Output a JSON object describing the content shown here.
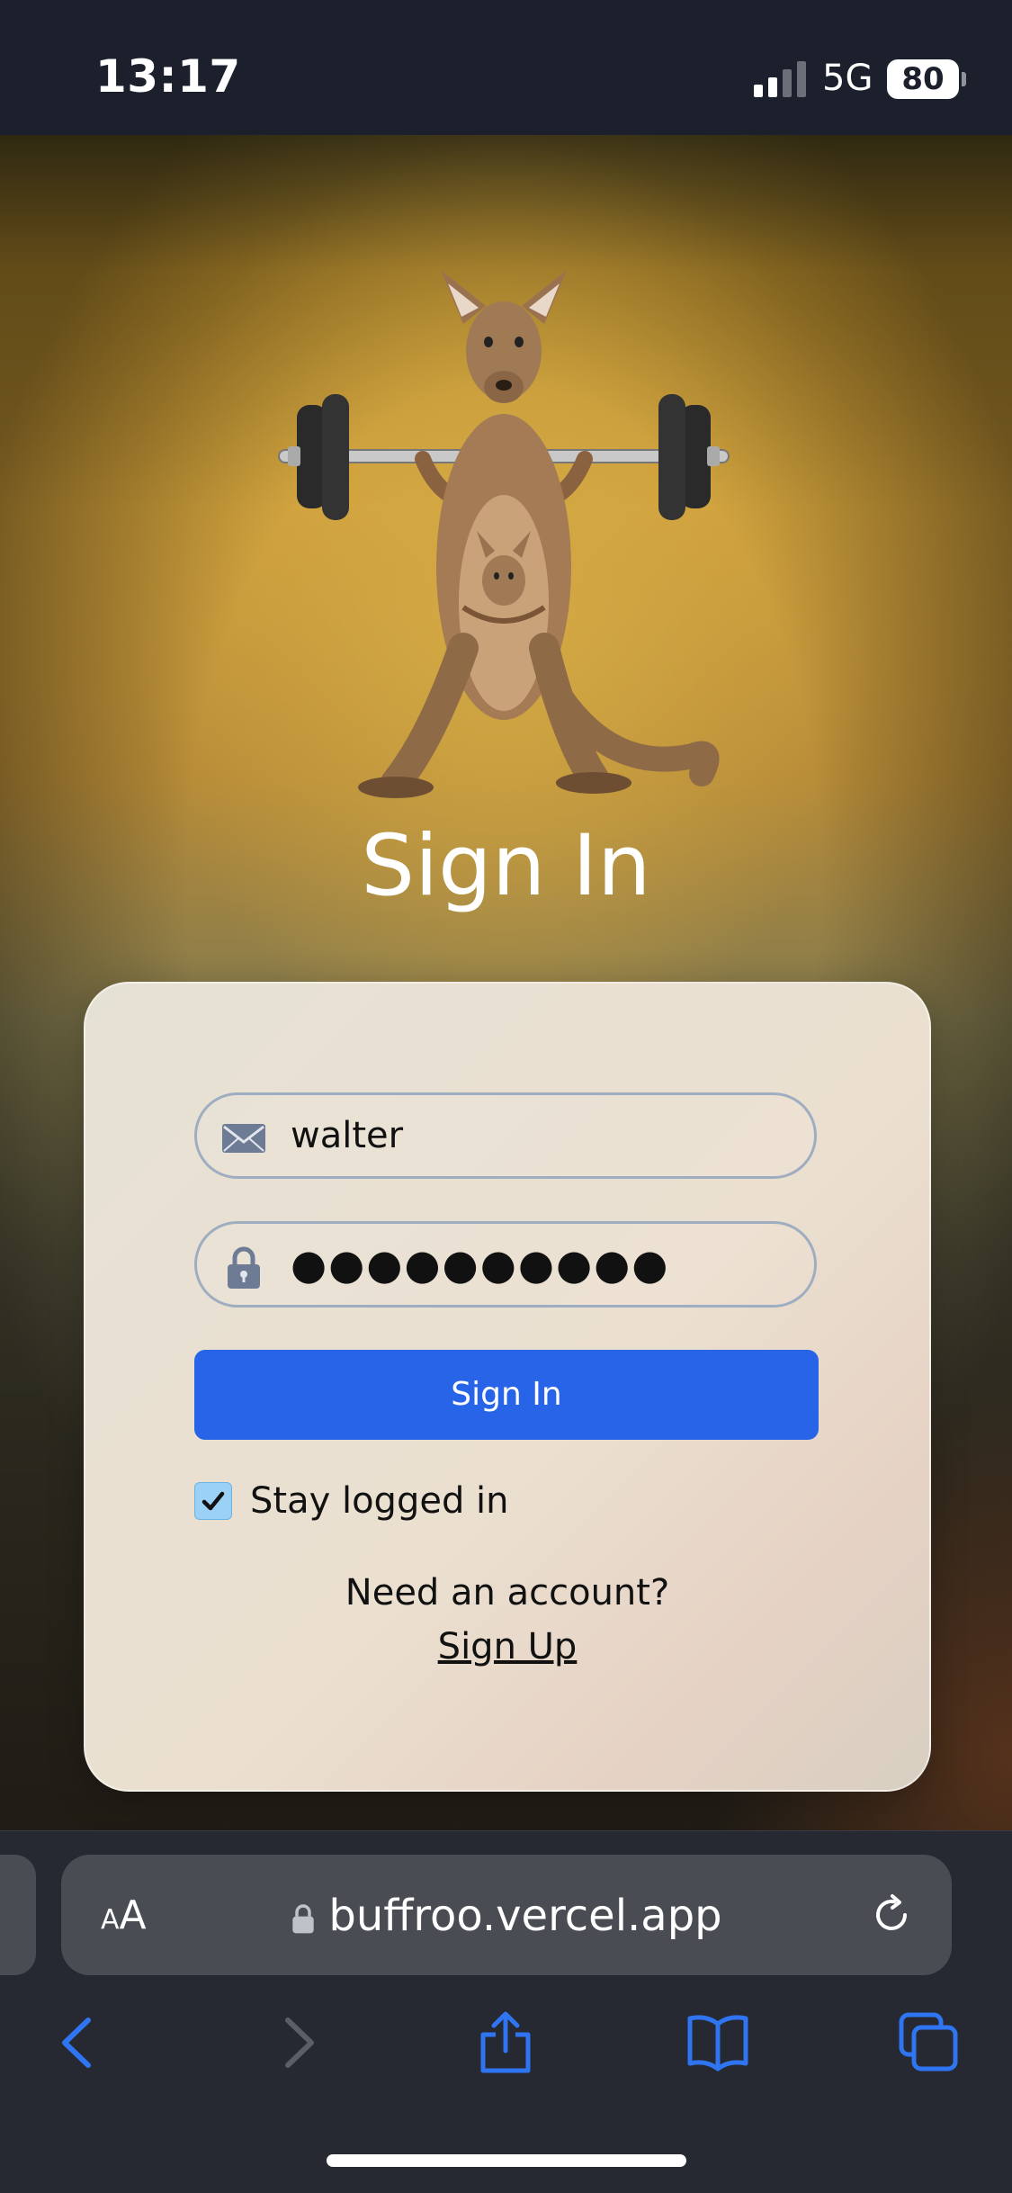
{
  "status_bar": {
    "time": "13:17",
    "network": "5G",
    "battery": "80"
  },
  "page": {
    "title": "Sign In",
    "form": {
      "username_value": "walter",
      "password_mask": "●●●●●●●●●●",
      "sign_in_label": "Sign In",
      "stay_logged_in_label": "Stay logged in",
      "stay_logged_in_checked": true,
      "need_account_text": "Need an account?",
      "sign_up_label": "Sign Up"
    }
  },
  "browser": {
    "text_size_label_small": "A",
    "text_size_label_large": "A",
    "url": "buffroo.vercel.app",
    "icons": [
      "back-icon",
      "forward-icon",
      "share-icon",
      "bookmarks-icon",
      "tabs-icon",
      "reload-icon",
      "lock-icon"
    ]
  },
  "colors": {
    "accent": "#2764e8",
    "background": "#1c202c"
  }
}
